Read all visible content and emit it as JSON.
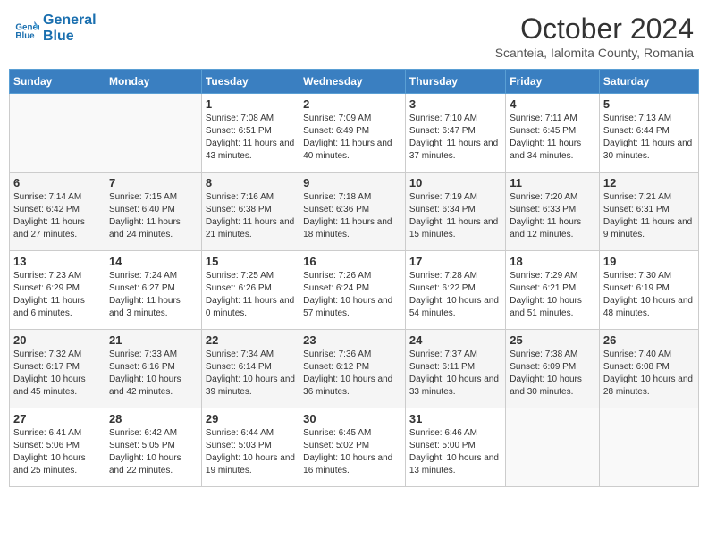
{
  "logo": {
    "line1": "General",
    "line2": "Blue"
  },
  "title": "October 2024",
  "location": "Scanteia, Ialomita County, Romania",
  "days_of_week": [
    "Sunday",
    "Monday",
    "Tuesday",
    "Wednesday",
    "Thursday",
    "Friday",
    "Saturday"
  ],
  "weeks": [
    [
      {
        "day": "",
        "info": ""
      },
      {
        "day": "",
        "info": ""
      },
      {
        "day": "1",
        "info": "Sunrise: 7:08 AM\nSunset: 6:51 PM\nDaylight: 11 hours and 43 minutes."
      },
      {
        "day": "2",
        "info": "Sunrise: 7:09 AM\nSunset: 6:49 PM\nDaylight: 11 hours and 40 minutes."
      },
      {
        "day": "3",
        "info": "Sunrise: 7:10 AM\nSunset: 6:47 PM\nDaylight: 11 hours and 37 minutes."
      },
      {
        "day": "4",
        "info": "Sunrise: 7:11 AM\nSunset: 6:45 PM\nDaylight: 11 hours and 34 minutes."
      },
      {
        "day": "5",
        "info": "Sunrise: 7:13 AM\nSunset: 6:44 PM\nDaylight: 11 hours and 30 minutes."
      }
    ],
    [
      {
        "day": "6",
        "info": "Sunrise: 7:14 AM\nSunset: 6:42 PM\nDaylight: 11 hours and 27 minutes."
      },
      {
        "day": "7",
        "info": "Sunrise: 7:15 AM\nSunset: 6:40 PM\nDaylight: 11 hours and 24 minutes."
      },
      {
        "day": "8",
        "info": "Sunrise: 7:16 AM\nSunset: 6:38 PM\nDaylight: 11 hours and 21 minutes."
      },
      {
        "day": "9",
        "info": "Sunrise: 7:18 AM\nSunset: 6:36 PM\nDaylight: 11 hours and 18 minutes."
      },
      {
        "day": "10",
        "info": "Sunrise: 7:19 AM\nSunset: 6:34 PM\nDaylight: 11 hours and 15 minutes."
      },
      {
        "day": "11",
        "info": "Sunrise: 7:20 AM\nSunset: 6:33 PM\nDaylight: 11 hours and 12 minutes."
      },
      {
        "day": "12",
        "info": "Sunrise: 7:21 AM\nSunset: 6:31 PM\nDaylight: 11 hours and 9 minutes."
      }
    ],
    [
      {
        "day": "13",
        "info": "Sunrise: 7:23 AM\nSunset: 6:29 PM\nDaylight: 11 hours and 6 minutes."
      },
      {
        "day": "14",
        "info": "Sunrise: 7:24 AM\nSunset: 6:27 PM\nDaylight: 11 hours and 3 minutes."
      },
      {
        "day": "15",
        "info": "Sunrise: 7:25 AM\nSunset: 6:26 PM\nDaylight: 11 hours and 0 minutes."
      },
      {
        "day": "16",
        "info": "Sunrise: 7:26 AM\nSunset: 6:24 PM\nDaylight: 10 hours and 57 minutes."
      },
      {
        "day": "17",
        "info": "Sunrise: 7:28 AM\nSunset: 6:22 PM\nDaylight: 10 hours and 54 minutes."
      },
      {
        "day": "18",
        "info": "Sunrise: 7:29 AM\nSunset: 6:21 PM\nDaylight: 10 hours and 51 minutes."
      },
      {
        "day": "19",
        "info": "Sunrise: 7:30 AM\nSunset: 6:19 PM\nDaylight: 10 hours and 48 minutes."
      }
    ],
    [
      {
        "day": "20",
        "info": "Sunrise: 7:32 AM\nSunset: 6:17 PM\nDaylight: 10 hours and 45 minutes."
      },
      {
        "day": "21",
        "info": "Sunrise: 7:33 AM\nSunset: 6:16 PM\nDaylight: 10 hours and 42 minutes."
      },
      {
        "day": "22",
        "info": "Sunrise: 7:34 AM\nSunset: 6:14 PM\nDaylight: 10 hours and 39 minutes."
      },
      {
        "day": "23",
        "info": "Sunrise: 7:36 AM\nSunset: 6:12 PM\nDaylight: 10 hours and 36 minutes."
      },
      {
        "day": "24",
        "info": "Sunrise: 7:37 AM\nSunset: 6:11 PM\nDaylight: 10 hours and 33 minutes."
      },
      {
        "day": "25",
        "info": "Sunrise: 7:38 AM\nSunset: 6:09 PM\nDaylight: 10 hours and 30 minutes."
      },
      {
        "day": "26",
        "info": "Sunrise: 7:40 AM\nSunset: 6:08 PM\nDaylight: 10 hours and 28 minutes."
      }
    ],
    [
      {
        "day": "27",
        "info": "Sunrise: 6:41 AM\nSunset: 5:06 PM\nDaylight: 10 hours and 25 minutes."
      },
      {
        "day": "28",
        "info": "Sunrise: 6:42 AM\nSunset: 5:05 PM\nDaylight: 10 hours and 22 minutes."
      },
      {
        "day": "29",
        "info": "Sunrise: 6:44 AM\nSunset: 5:03 PM\nDaylight: 10 hours and 19 minutes."
      },
      {
        "day": "30",
        "info": "Sunrise: 6:45 AM\nSunset: 5:02 PM\nDaylight: 10 hours and 16 minutes."
      },
      {
        "day": "31",
        "info": "Sunrise: 6:46 AM\nSunset: 5:00 PM\nDaylight: 10 hours and 13 minutes."
      },
      {
        "day": "",
        "info": ""
      },
      {
        "day": "",
        "info": ""
      }
    ]
  ]
}
